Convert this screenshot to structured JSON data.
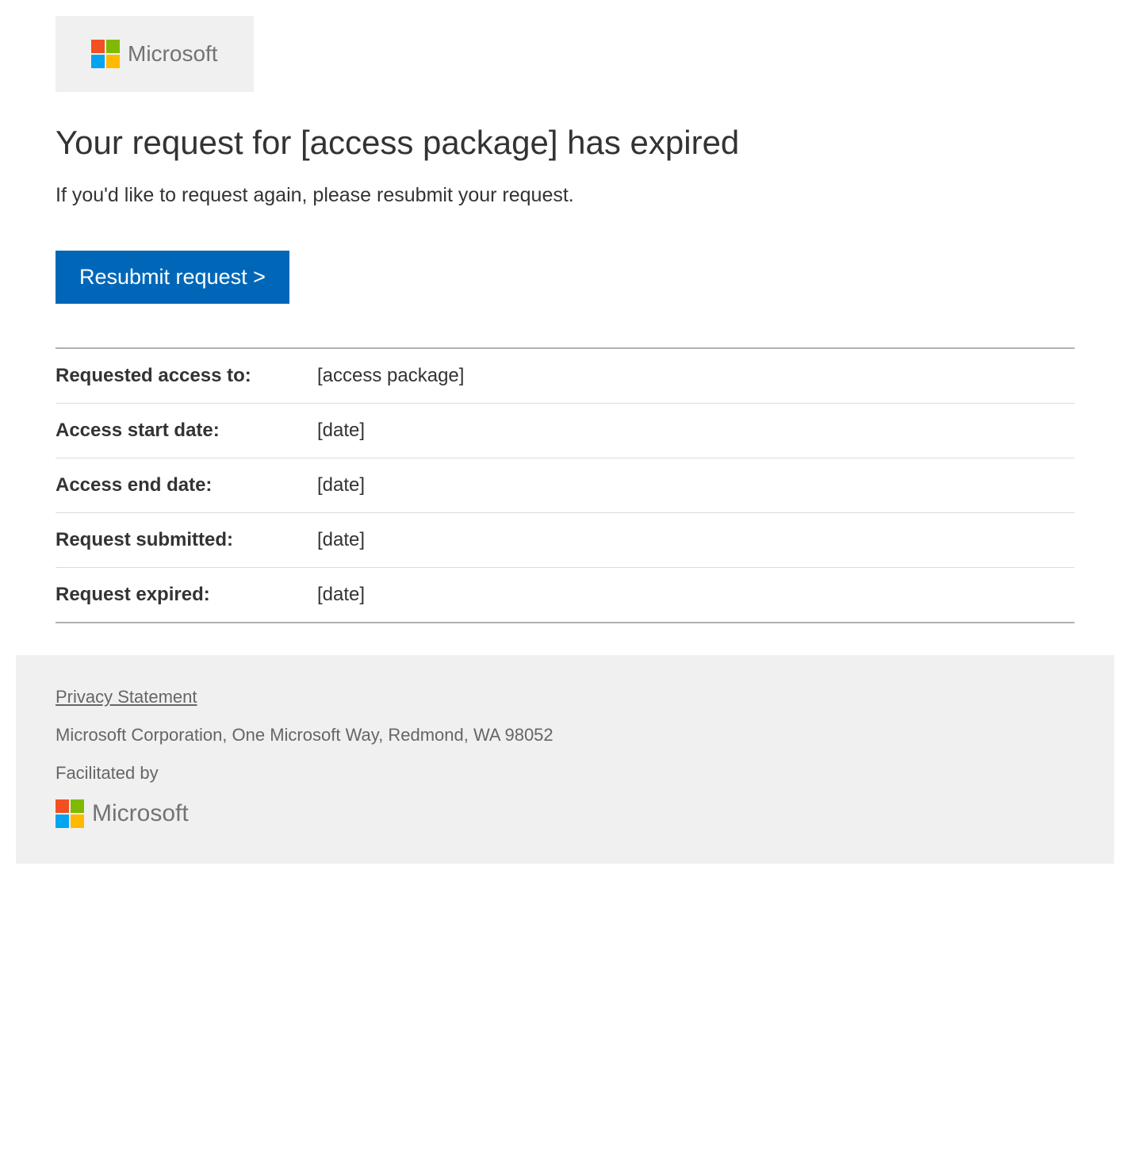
{
  "header": {
    "brand": "Microsoft"
  },
  "main": {
    "title": "Your request for [access package] has expired",
    "subtitle": "If you'd like to request again, please resubmit your request.",
    "button_label": "Resubmit request >"
  },
  "details": {
    "rows": [
      {
        "label": "Requested access to:",
        "value": "[access package]"
      },
      {
        "label": "Access start date:",
        "value": "[date]"
      },
      {
        "label": "Access end date:",
        "value": "[date]"
      },
      {
        "label": "Request submitted:",
        "value": "[date]"
      },
      {
        "label": "Request expired:",
        "value": "[date]"
      }
    ]
  },
  "footer": {
    "privacy_link": "Privacy Statement",
    "address": "Microsoft Corporation, One Microsoft Way, Redmond, WA 98052",
    "facilitated_by": "Facilitated by",
    "brand": "Microsoft"
  }
}
